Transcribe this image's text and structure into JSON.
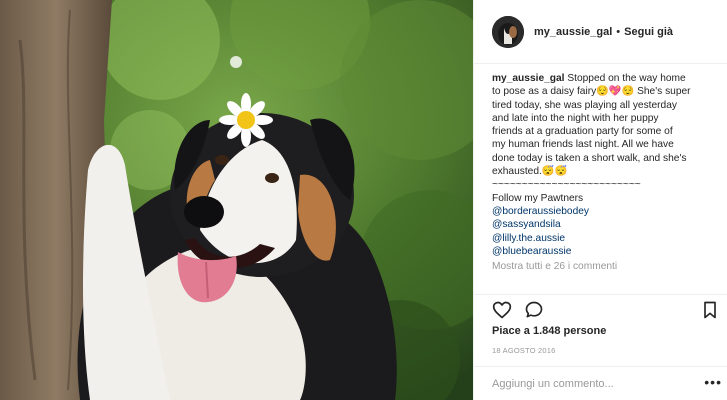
{
  "post": {
    "username": "my_aussie_gal",
    "separator": "•",
    "follow_status": "Segui già",
    "caption_username": "my_aussie_gal",
    "caption_lines": [
      "Stopped on the way home",
      "to pose as a daisy fairy😌💖😌 She's super",
      "tired today, she was playing all yesterday",
      "and late into the night with her puppy",
      "friends at a graduation party for some of",
      "my human friends last night. All we have",
      "done today is taken a short walk, and she's",
      "exhausted.😴😴",
      "~~~~~~~~~~~~~~~~~~~~~~~~~",
      "Follow my Pawtners"
    ],
    "mentions": [
      "@borderaussiebodey",
      "@sassyandsila",
      "@lilly.the.aussie",
      "@bluebearaussie"
    ],
    "load_more": "Mostra tutti e 26 i commenti",
    "likes": "Piace a 1.848 persone",
    "date": "18 AGOSTO 2016",
    "comment_placeholder": "Aggiungi un commento...",
    "more_glyph": "•••"
  },
  "icons": {
    "like": "heart-outline-icon",
    "comment": "speech-bubble-icon",
    "save": "bookmark-icon",
    "more": "ellipsis-icon"
  },
  "colors": {
    "text": "#262626",
    "secondary": "#999999",
    "mention": "#003569",
    "divider": "#efefef"
  }
}
